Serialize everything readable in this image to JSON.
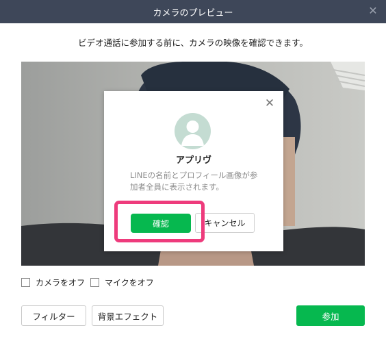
{
  "window": {
    "title": "カメラのプレビュー",
    "close_icon": "close-icon"
  },
  "instruction": "ビデオ通話に参加する前に、カメラの映像を確認できます。",
  "modal": {
    "name": "アプリヴ",
    "description_line1": "LINEの名前とプロフィール画像が参",
    "description_line2": "加者全員に表示されます。",
    "confirm_label": "確認",
    "cancel_label": "キャンセル",
    "close_icon": "close-icon",
    "avatar_icon": "default-avatar-icon"
  },
  "options": {
    "camera_off_label": "カメラをオフ",
    "camera_off_checked": false,
    "mic_off_label": "マイクをオフ",
    "mic_off_checked": false
  },
  "footer": {
    "filter_label": "フィルター",
    "background_effect_label": "背景エフェクト",
    "join_label": "参加"
  },
  "colors": {
    "titlebar": "#3e4759",
    "primary_green": "#06b84f",
    "highlight": "#ee3b7c"
  }
}
